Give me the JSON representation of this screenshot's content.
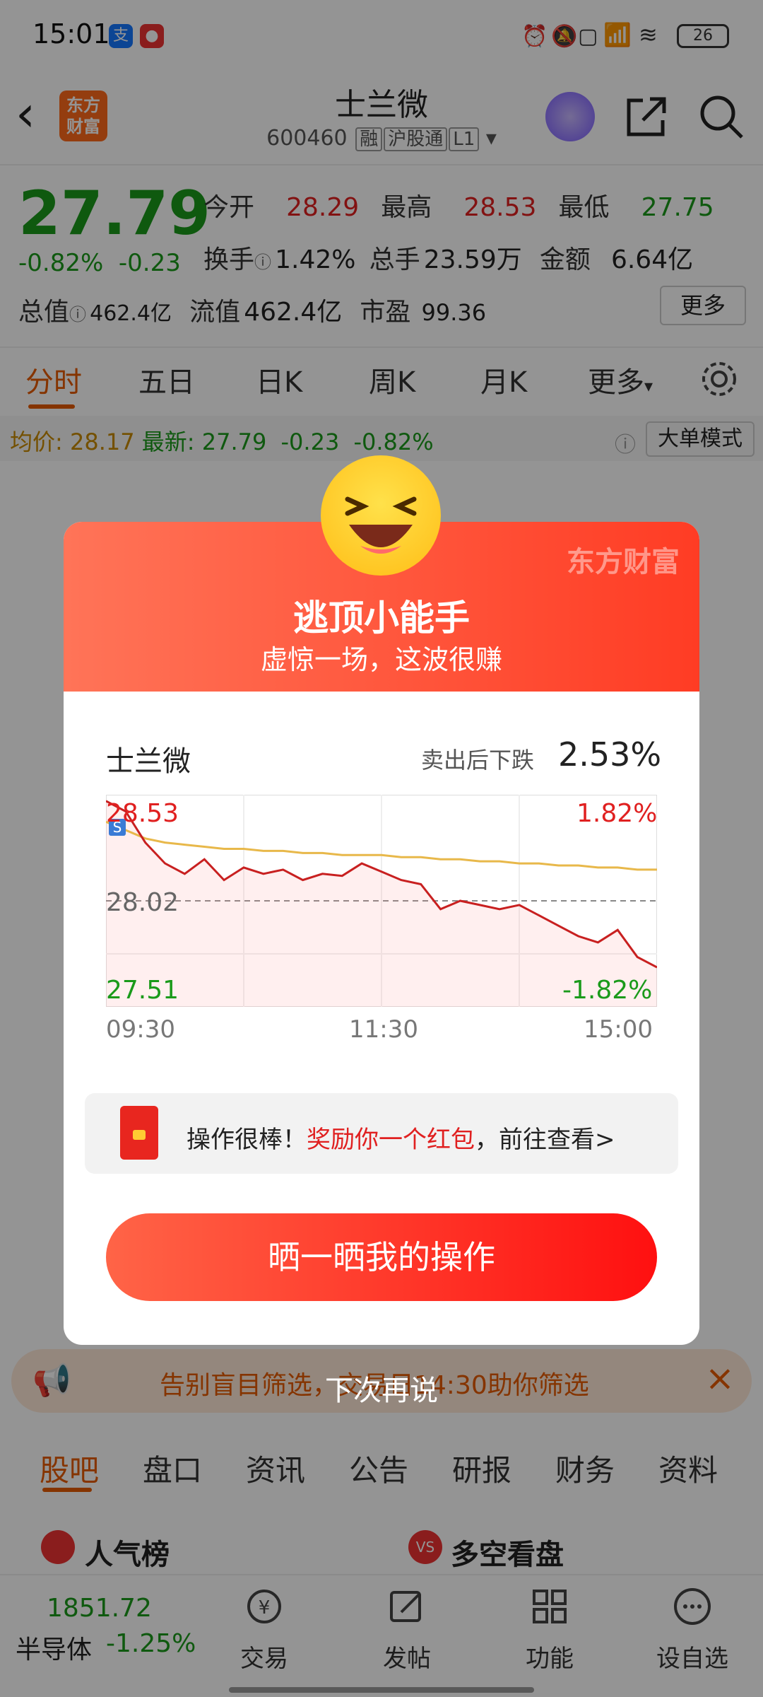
{
  "status_bar": {
    "time": "15:01",
    "battery": "26"
  },
  "header": {
    "back_icon": "back-arrow-icon",
    "logo_text": "东方财富",
    "title": "士兰微",
    "code": "600460",
    "tags": [
      "融",
      "沪股通",
      "L1"
    ]
  },
  "quote": {
    "price": "27.79",
    "change_pct": "-0.82%",
    "change_amt": "-0.23",
    "open_label": "今开",
    "open": "28.29",
    "high_label": "最高",
    "high": "28.53",
    "low_label": "最低",
    "low": "27.75",
    "turnover_label": "换手",
    "turnover": "1.42%",
    "volume_label": "总手",
    "volume": "23.59万",
    "amount_label": "金额",
    "amount": "6.64亿",
    "mktcap_label": "总值",
    "mktcap": "462.4亿",
    "float_label": "流值",
    "float": "462.4亿",
    "pe_label": "市盈",
    "pe": "99.36",
    "more": "更多"
  },
  "tabs": [
    "分时",
    "五日",
    "日K",
    "周K",
    "月K",
    "更多"
  ],
  "intraday": {
    "avg_label": "均价:",
    "avg": "28.17",
    "latest_label": "最新:",
    "latest": "27.79",
    "chg": "-0.23",
    "pct": "-0.82%",
    "big_mode": "大单模式"
  },
  "modal": {
    "brand": "东方财富",
    "title": "逃顶小能手",
    "subtitle": "虚惊一场，这波很赚",
    "stock": "士兰微",
    "drop_label": "卖出后下跌",
    "drop_value": "2.53%",
    "reward_prefix": "操作很棒！",
    "reward_highlight": "奖励你一个红包",
    "reward_suffix": "，前往查看>",
    "share_button": "晒一晒我的操作",
    "later": "下次再说"
  },
  "chart_data": {
    "type": "line",
    "y_max_label": "28.53",
    "y_mid_label": "28.02",
    "y_min_label": "27.51",
    "pct_max_label": "1.82%",
    "pct_min_label": "-1.82%",
    "x_ticks": [
      "09:30",
      "11:30",
      "15:00"
    ],
    "ylim": [
      27.51,
      28.53
    ],
    "series": [
      {
        "name": "",
        "values": [
          28.5,
          28.45,
          28.3,
          28.2,
          28.15,
          28.22,
          28.12,
          28.18,
          28.15,
          28.17,
          28.12,
          28.15,
          28.14,
          28.2,
          28.16,
          28.12,
          28.1,
          27.98,
          28.02,
          28.0,
          27.98,
          28.0,
          27.95,
          27.9,
          27.85,
          27.82,
          27.88,
          27.75,
          27.7
        ]
      },
      {
        "name": "",
        "values": [
          28.4,
          28.36,
          28.32,
          28.3,
          28.29,
          28.28,
          28.27,
          28.27,
          28.26,
          28.26,
          28.25,
          28.25,
          28.24,
          28.24,
          28.24,
          28.23,
          28.23,
          28.22,
          28.22,
          28.21,
          28.21,
          28.2,
          28.2,
          28.19,
          28.19,
          28.18,
          28.18,
          28.17,
          28.17
        ]
      }
    ]
  },
  "ticker": "告别盲目筛选，交易日14:30助你筛选",
  "nav_tabs": [
    "股吧",
    "盘口",
    "资讯",
    "公告",
    "研报",
    "财务",
    "资料"
  ],
  "cards": [
    "人气榜",
    "多空看盘"
  ],
  "bottom": {
    "index_value": "1851.72",
    "index_name": "半导体",
    "index_change": "-1.25%",
    "items": [
      "交易",
      "发帖",
      "功能",
      "设自选"
    ]
  }
}
